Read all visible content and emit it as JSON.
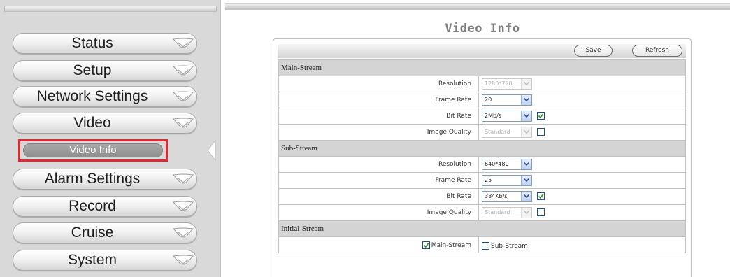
{
  "nav": {
    "items": [
      {
        "label": "Status"
      },
      {
        "label": "Setup"
      },
      {
        "label": "Network Settings"
      },
      {
        "label": "Video"
      },
      {
        "label": "Alarm Settings"
      },
      {
        "label": "Record"
      },
      {
        "label": "Cruise"
      },
      {
        "label": "System"
      }
    ],
    "active_sub_item": "Video Info"
  },
  "page": {
    "title": "Video Info"
  },
  "toolbar": {
    "save_label": "Save",
    "refresh_label": "Refresh"
  },
  "main_stream": {
    "header": "Main-Stream",
    "resolution_label": "Resolution",
    "resolution_value": "1280*720",
    "frame_rate_label": "Frame Rate",
    "frame_rate_value": "20",
    "bit_rate_label": "Bit Rate",
    "bit_rate_value": "2Mb/s",
    "bit_rate_checked": true,
    "image_quality_label": "Image Quality",
    "image_quality_value": "Standard",
    "image_quality_checked": false
  },
  "sub_stream": {
    "header": "Sub-Stream",
    "resolution_label": "Resolution",
    "resolution_value": "640*480",
    "frame_rate_label": "Frame Rate",
    "frame_rate_value": "25",
    "bit_rate_label": "Bit Rate",
    "bit_rate_value": "384Kb/s",
    "bit_rate_checked": true,
    "image_quality_label": "Image Quality",
    "image_quality_value": "Standard",
    "image_quality_checked": false
  },
  "initial_stream": {
    "header": "Initial-Stream",
    "main_label": "Main-Stream",
    "main_checked": true,
    "sub_label": "Sub-Stream",
    "sub_checked": false
  },
  "colors": {
    "highlight_border": "#e3262f",
    "section_bg": "#d4d4d4",
    "sidebar_bg": "#d9d9d9"
  }
}
